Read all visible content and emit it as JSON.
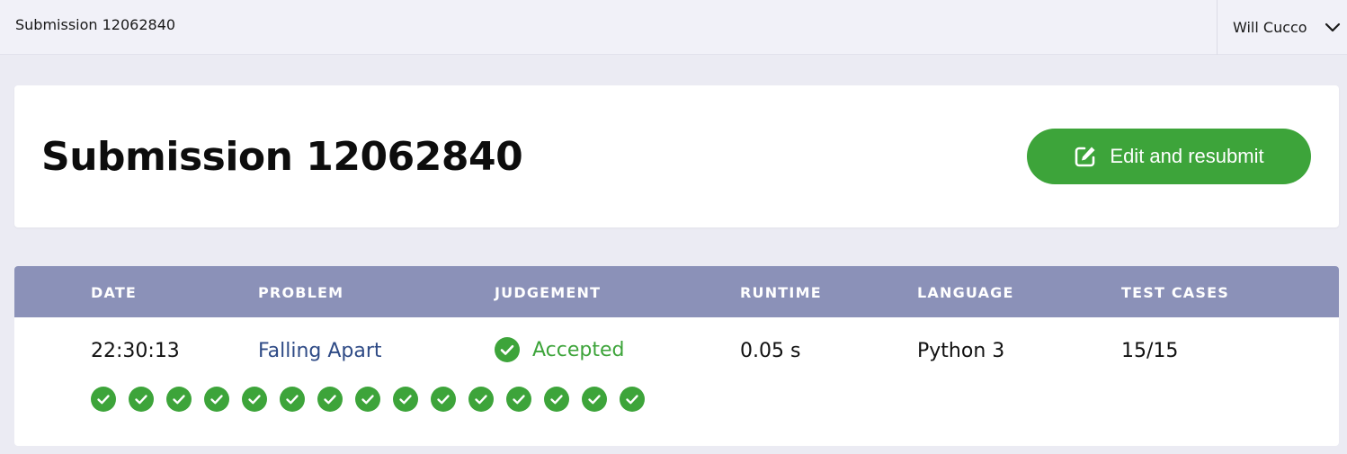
{
  "topbar": {
    "title": "Submission 12062840",
    "user_name": "Will Cucco",
    "chevron_icon": "chevron-down-icon"
  },
  "header": {
    "title": "Submission 12062840",
    "resubmit_label": "Edit and resubmit",
    "resubmit_icon": "edit-icon"
  },
  "table": {
    "columns": [
      "DATE",
      "PROBLEM",
      "JUDGEMENT",
      "RUNTIME",
      "LANGUAGE",
      "TEST CASES"
    ],
    "row": {
      "date": "22:30:13",
      "problem": "Falling Apart",
      "judgement": "Accepted",
      "runtime": "0.05 s",
      "language": "Python 3",
      "test_cases": "15/15"
    },
    "test_results": [
      "accepted",
      "accepted",
      "accepted",
      "accepted",
      "accepted",
      "accepted",
      "accepted",
      "accepted",
      "accepted",
      "accepted",
      "accepted",
      "accepted",
      "accepted",
      "accepted",
      "accepted"
    ]
  },
  "colors": {
    "accent_green": "#3da43a",
    "header_bg": "#8b91b8",
    "link": "#2f4b86"
  }
}
